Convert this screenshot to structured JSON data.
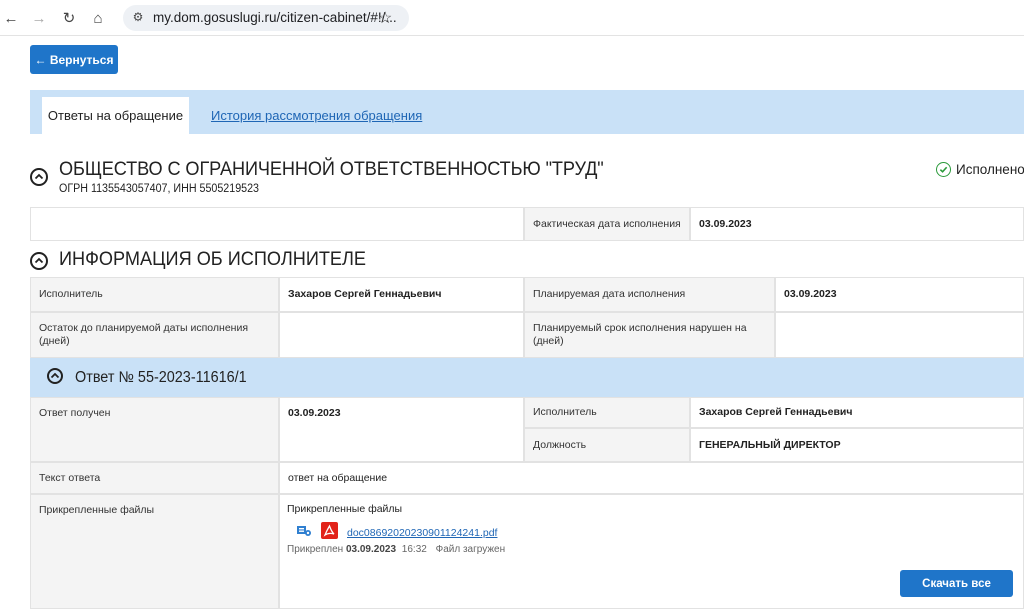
{
  "browser": {
    "url": "my.dom.gosuslugi.ru/citizen-cabinet/#!/..."
  },
  "back_button": {
    "label": "← Вернуться"
  },
  "tabs": [
    {
      "label": "Ответы на обращение",
      "active": true
    },
    {
      "label": "История рассмотрения обращения",
      "active": false
    }
  ],
  "organization": {
    "name": "ОБЩЕСТВО С ОГРАНИЧЕННОЙ ОТВЕТСТВЕННОСТЬЮ \"ТРУД\"",
    "details": "ОГРН 1135543057407, ИНН 5505219523",
    "status": "Исполнено",
    "status_color": "#2a9a3a",
    "actual_date_label": "Фактическая дата исполнения",
    "actual_date_value": "03.09.2023"
  },
  "executor_section": {
    "title": "ИНФОРМАЦИЯ ОБ ИСПОЛНИТЕЛЕ",
    "executor_label": "Исполнитель",
    "executor_value": "Захаров Сергей Геннадьевич",
    "planned_date_label": "Планируемая дата исполнения",
    "planned_date_value": "03.09.2023",
    "remaining_label": "Остаток до планируемой даты исполнения (дней)",
    "remaining_value": "",
    "violated_label": "Планируемый срок исполнения нарушен на (дней)",
    "violated_value": ""
  },
  "answer": {
    "title": "Ответ № 55-2023-11616/1",
    "received_label": "Ответ получен",
    "received_value": "03.09.2023",
    "executor_label": "Исполнитель",
    "executor_value": "Захаров Сергей Геннадьевич",
    "position_label": "Должность",
    "position_value": "ГЕНЕРАЛЬНЫЙ ДИРЕКТОР",
    "text_label": "Текст ответа",
    "text_value": "ответ на обращение",
    "files_label": "Прикрепленные файлы",
    "files_heading": "Прикрепленные файлы",
    "file_name": "doc08692020230901124241.pdf",
    "attached_prefix": "Прикреплен",
    "attached_date": "03.09.2023",
    "attached_time": "16:32",
    "upload_status": "Файл загружен",
    "download_all": "Скачать все"
  },
  "colors": {
    "primary_button": "#1f75c9",
    "band": "#c9e1f7",
    "link": "#1f66b5"
  }
}
